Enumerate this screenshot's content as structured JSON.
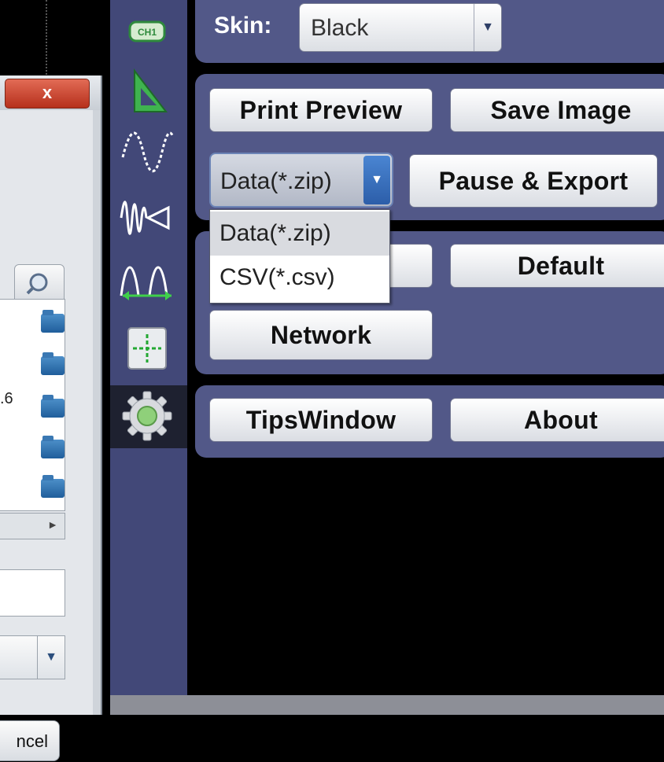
{
  "dialog": {
    "close_label": "x",
    "partial_text": ".6",
    "cancel_label": "ncel"
  },
  "rail": {
    "icons": [
      "ch1-icon",
      "triangle-ruler-icon",
      "sine-wave-icon",
      "fft-wave-icon",
      "measure-wave-icon",
      "cursor-cross-icon",
      "gear-icon"
    ],
    "ch1_label": "CH1",
    "selected": "gear-icon"
  },
  "skin": {
    "label": "Skin:",
    "value": "Black"
  },
  "buttons": {
    "print_preview": "Print Preview",
    "save_image": "Save Image",
    "pause_export": "Pause & Export",
    "default": "Default",
    "network": "Network",
    "tips_window": "TipsWindow",
    "about": "About"
  },
  "export_format": {
    "value": "Data(*.zip)",
    "options": [
      "Data(*.zip)",
      "CSV(*.csv)"
    ],
    "highlighted": 0
  },
  "colors": {
    "panel_bg": "#3c4168",
    "group_bg": "#525888",
    "rail_bg": "#424878",
    "accent_arrow": "#2c5ea9"
  }
}
